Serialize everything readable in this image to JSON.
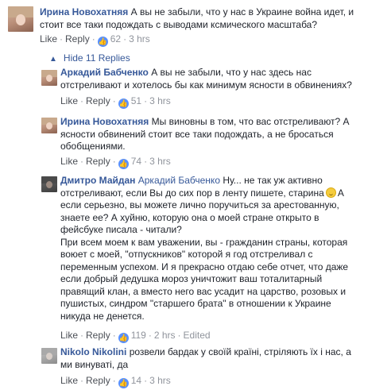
{
  "comments": [
    {
      "author": "Ирина Новохатняя",
      "lines": [
        "А вы не забыли, что у нас в Украине война идет, и",
        "стоит все таки подождать с выводами ксмического масштаба?"
      ],
      "like": "Like",
      "reply": "Reply",
      "likes": "62",
      "time": "3 hrs"
    }
  ],
  "hide_replies": "Hide 11 Replies",
  "replies": [
    {
      "author": "Аркадий Бабченко",
      "lines": [
        "А вы не забыли, что у нас здесь нас",
        "отстреливают и хотелось бы как минимум ясности в обвинениях?"
      ],
      "like": "Like",
      "reply": "Reply",
      "likes": "51",
      "time": "3 hrs"
    },
    {
      "author": "Ирина Новохатняя",
      "lines": [
        "Мы виновны в том, что вас отстреливают? А",
        "ясности обвинений стоит все таки подождать, а не бросаться",
        "обобщениями."
      ],
      "like": "Like",
      "reply": "Reply",
      "likes": "74",
      "time": "3 hrs"
    },
    {
      "author": "Дмитро Майдан",
      "mention": "Аркадий Бабченко",
      "first_line_rest": "Ну... не так уж активно",
      "line2_before_emoji": "отстреливают, если Вы до сих пор в ленту пишете, старина",
      "line2_after_emoji": "А",
      "lines": [
        "если серьезно, вы можете лично поручиться за арестованную,",
        "знаете ее? А хуйню, которую она о моей стране открыто в",
        "фейсбуке писала - читали?",
        "При всем моем к вам уважении, вы - гражданин страны, которая",
        "воюет с моей, \"отпускников\" которой я год отстреливал с",
        "переменным успехом. И я прекрасно отдаю себе отчет, что даже",
        "если добрый дедушка мороз уничтожит ваш тоталитарный",
        "правящий клан, а вместо него вас усадит на царство, розовых и",
        "пушистых, синдром \"старшего брата\" в отношении к Украине",
        "никуда не денется."
      ],
      "like": "Like",
      "reply": "Reply",
      "likes": "119",
      "time": "2 hrs",
      "edited": "Edited"
    },
    {
      "author": "Nikolo Nikolini",
      "lines": [
        "розвели бардак у своїй країні, стріляють їх і нас, а",
        "ми винуваті, да"
      ],
      "like": "Like",
      "reply": "Reply",
      "likes": "14",
      "time": "3 hrs"
    }
  ],
  "colors": {
    "link": "#365899",
    "meta": "#90949c",
    "like_badge": "#5890ff"
  },
  "icons": [
    "like-icon",
    "smile-emoji",
    "chevron-up-icon"
  ]
}
